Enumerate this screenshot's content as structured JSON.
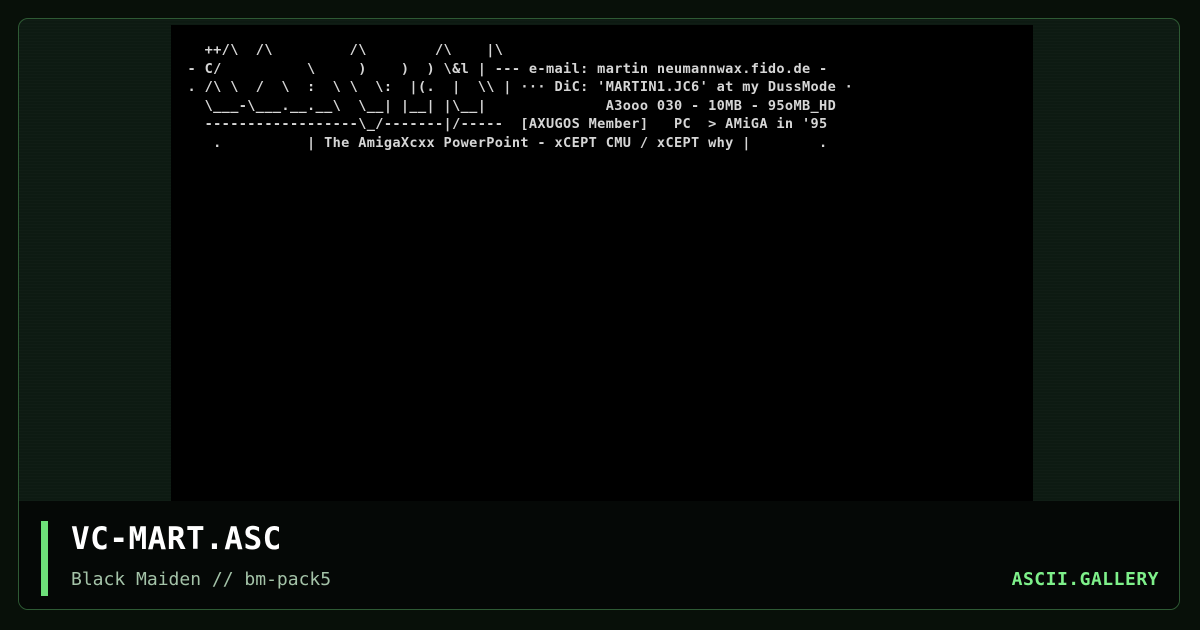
{
  "art": {
    "lines": [
      "   ++/\\  /\\         /\\        /\\    |\\",
      " - C/          \\     )    )  ) \\&l | --- e-mail: martin neumannwax.fido.de -",
      " . /\\ \\  /  \\  :  \\ \\  \\:  |(.  |  \\\\ | ··· DiC: 'MARTIN1.JC6' at my DussMode ·",
      "   \\___-\\___.__.__\\  \\__| |__| |\\__|              A3ooo 030 - 10MB - 95oMB_HD",
      "   ------------------\\_/-------|/-----  [AXUGOS Member]   PC  > AMiGA in '95",
      "    .          | The AmigaXcxx PowerPoint - xCEPT CMU / xCEPT why |        ."
    ]
  },
  "footer": {
    "title": "VC-MART.ASC",
    "subtitle": "Black Maiden // bm-pack5",
    "brand": "ASCII.GALLERY"
  },
  "colors": {
    "accent": "#6ee07a",
    "brand": "#7ef08a",
    "background": "#0d1a12",
    "art_background": "#000000"
  }
}
